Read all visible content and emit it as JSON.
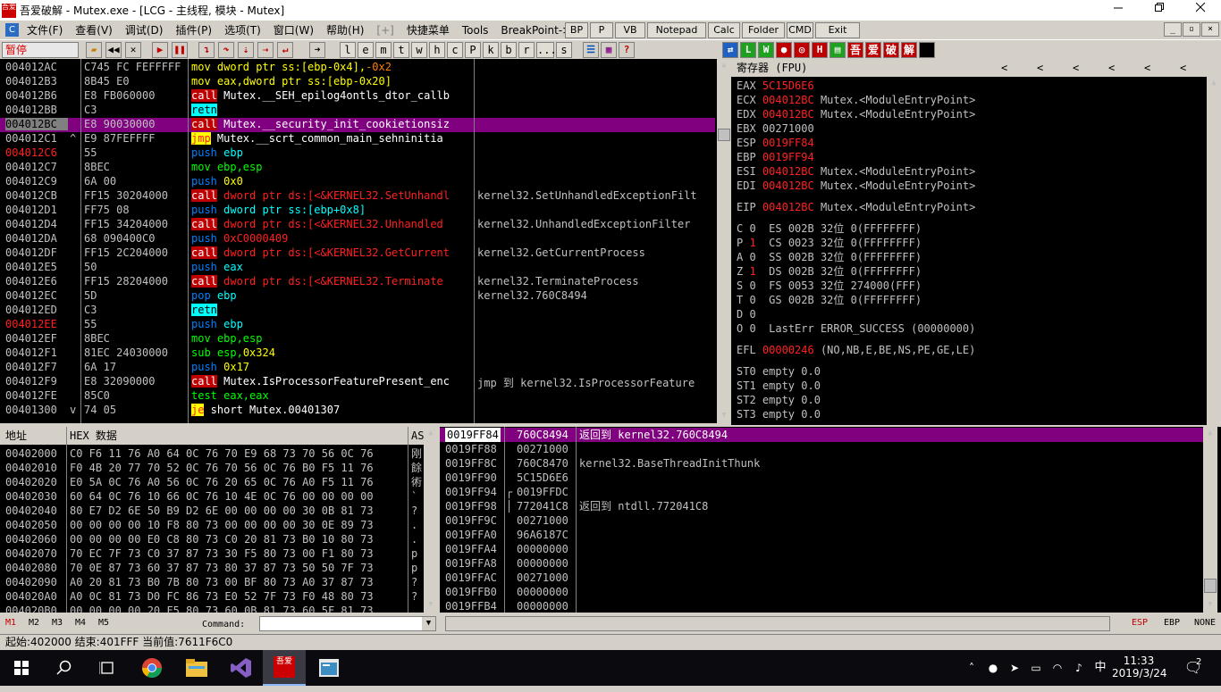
{
  "window": {
    "title": "吾爱破解 - Mutex.exe - [LCG - 主线程, 模块 - Mutex]",
    "icon_text": "吾爱",
    "controls": [
      "minimize-icon",
      "restore-icon",
      "close-icon"
    ]
  },
  "menu": {
    "items": [
      "文件(F)",
      "查看(V)",
      "调试(D)",
      "插件(P)",
      "选项(T)",
      "窗口(W)",
      "帮助(H)",
      "[+]",
      "快捷菜单",
      "Tools",
      "BreakPoint->"
    ],
    "plugin_buttons": [
      "BP",
      "P",
      "VB",
      "Notepad",
      "Calc",
      "Folder",
      "CMD",
      "Exit"
    ],
    "mdi_buttons": [
      "_",
      "▫",
      "×"
    ]
  },
  "toolbar": {
    "status": "暂停",
    "buttons": [
      "open",
      "rewind",
      "close",
      "run",
      "pause",
      "step-into",
      "step-over",
      "trace-into",
      "trace-over",
      "execute-till-return",
      "goto"
    ],
    "letter_buttons": [
      "l",
      "e",
      "m",
      "t",
      "w",
      "h",
      "c",
      "P",
      "k",
      "b",
      "r",
      "...",
      "s"
    ],
    "right_labels": [
      "L",
      "W",
      "H",
      "吾",
      "爱",
      "破",
      "解"
    ]
  },
  "cpu": {
    "rows": [
      {
        "addr": "004012AC",
        "hex": "C745 FC FEFFFFF",
        "dis": [
          {
            "t": "mov",
            "c": "#ffff00",
            "bg": ""
          },
          {
            "t": " dword ptr ss:[ebp-0x4],",
            "c": "#ffff00",
            "bg": ""
          },
          {
            "t": "-0x2",
            "c": "#ff8000",
            "bg": ""
          }
        ],
        "com": "",
        "addr_color": "#c0c0c0",
        "mark": ""
      },
      {
        "addr": "004012B3",
        "hex": "8B45 E0",
        "dis": [
          {
            "t": "mov",
            "c": "#ffff00",
            "bg": ""
          },
          {
            "t": " eax,dword ptr ss:[ebp-0x20]",
            "c": "#ffff00",
            "bg": ""
          }
        ],
        "com": "",
        "addr_color": "#c0c0c0",
        "mark": ""
      },
      {
        "addr": "004012B6",
        "hex": "E8 FB060000",
        "dis": [
          {
            "t": "call",
            "c": "#ffffff",
            "bg": "#c00000"
          },
          {
            "t": " Mutex.__SEH_epilog4ontls_dtor_callb",
            "c": "#ffffff",
            "bg": ""
          }
        ],
        "com": "",
        "addr_color": "#c0c0c0",
        "mark": ""
      },
      {
        "addr": "004012BB",
        "hex": "C3",
        "dis": [
          {
            "t": "retn",
            "c": "#000000",
            "bg": "#00ffff"
          }
        ],
        "com": "",
        "addr_color": "#c0c0c0",
        "mark": ""
      },
      {
        "addr": "004012BC",
        "hex": "E8 90030000",
        "dis": [
          {
            "t": "call",
            "c": "#ffffff",
            "bg": "#c00000"
          },
          {
            "t": " Mutex.__security_init_cookietionsiz",
            "c": "#ffffff",
            "bg": ""
          }
        ],
        "com": "",
        "addr_color": "#000000",
        "mark": "",
        "selected": true
      },
      {
        "addr": "004012C1",
        "hex": "E9 87FEFFFF",
        "dis": [
          {
            "t": "jmp",
            "c": "#ff2020",
            "bg": "#ffff00"
          },
          {
            "t": " Mutex.__scrt_common_main_sehninitia",
            "c": "#ffffff",
            "bg": ""
          }
        ],
        "com": "",
        "addr_color": "#c0c0c0",
        "mark": "^"
      },
      {
        "addr": "004012C6",
        "hex": "55",
        "dis": [
          {
            "t": "push",
            "c": "#0080ff",
            "bg": ""
          },
          {
            "t": " ebp",
            "c": "#00ffff",
            "bg": ""
          }
        ],
        "com": "",
        "addr_color": "#ff2020",
        "mark": ""
      },
      {
        "addr": "004012C7",
        "hex": "8BEC",
        "dis": [
          {
            "t": "mov",
            "c": "#00ff00",
            "bg": ""
          },
          {
            "t": " ebp,esp",
            "c": "#00ff00",
            "bg": ""
          }
        ],
        "com": "",
        "addr_color": "#c0c0c0",
        "mark": ""
      },
      {
        "addr": "004012C9",
        "hex": "6A 00",
        "dis": [
          {
            "t": "push",
            "c": "#0080ff",
            "bg": ""
          },
          {
            "t": " 0x0",
            "c": "#ffff00",
            "bg": ""
          }
        ],
        "com": "",
        "addr_color": "#c0c0c0",
        "mark": ""
      },
      {
        "addr": "004012CB",
        "hex": "FF15 30204000",
        "dis": [
          {
            "t": "call",
            "c": "#ffffff",
            "bg": "#c00000"
          },
          {
            "t": " dword ptr ds:[<&KERNEL32.SetUnhandl",
            "c": "#ff2020",
            "bg": ""
          }
        ],
        "com": "kernel32.SetUnhandledExceptionFilt",
        "addr_color": "#c0c0c0",
        "mark": ""
      },
      {
        "addr": "004012D1",
        "hex": "FF75 08",
        "dis": [
          {
            "t": "push",
            "c": "#0080ff",
            "bg": ""
          },
          {
            "t": " dword ptr ss:[ebp+0x8]",
            "c": "#00ffff",
            "bg": ""
          }
        ],
        "com": "",
        "addr_color": "#c0c0c0",
        "mark": ""
      },
      {
        "addr": "004012D4",
        "hex": "FF15 34204000",
        "dis": [
          {
            "t": "call",
            "c": "#ffffff",
            "bg": "#c00000"
          },
          {
            "t": " dword ptr ds:[<&KERNEL32.Unhandled",
            "c": "#ff2020",
            "bg": ""
          }
        ],
        "com": "kernel32.UnhandledExceptionFilter",
        "addr_color": "#c0c0c0",
        "mark": ""
      },
      {
        "addr": "004012DA",
        "hex": "68 090400C0",
        "dis": [
          {
            "t": "push",
            "c": "#0080ff",
            "bg": ""
          },
          {
            "t": " 0xC0000409",
            "c": "#ff2020",
            "bg": ""
          }
        ],
        "com": "",
        "addr_color": "#c0c0c0",
        "mark": ""
      },
      {
        "addr": "004012DF",
        "hex": "FF15 2C204000",
        "dis": [
          {
            "t": "call",
            "c": "#ffffff",
            "bg": "#c00000"
          },
          {
            "t": " dword ptr ds:[<&KERNEL32.GetCurrent",
            "c": "#ff2020",
            "bg": ""
          }
        ],
        "com": "kernel32.GetCurrentProcess",
        "addr_color": "#c0c0c0",
        "mark": ""
      },
      {
        "addr": "004012E5",
        "hex": "50",
        "dis": [
          {
            "t": "push",
            "c": "#0080ff",
            "bg": ""
          },
          {
            "t": " eax",
            "c": "#00ffff",
            "bg": ""
          }
        ],
        "com": "",
        "addr_color": "#c0c0c0",
        "mark": ""
      },
      {
        "addr": "004012E6",
        "hex": "FF15 28204000",
        "dis": [
          {
            "t": "call",
            "c": "#ffffff",
            "bg": "#c00000"
          },
          {
            "t": " dword ptr ds:[<&KERNEL32.Terminate",
            "c": "#ff2020",
            "bg": ""
          }
        ],
        "com": "kernel32.TerminateProcess",
        "addr_color": "#c0c0c0",
        "mark": ""
      },
      {
        "addr": "004012EC",
        "hex": "5D",
        "dis": [
          {
            "t": "pop",
            "c": "#0080ff",
            "bg": ""
          },
          {
            "t": " ebp",
            "c": "#00ffff",
            "bg": ""
          }
        ],
        "com": "kernel32.760C8494",
        "addr_color": "#c0c0c0",
        "mark": ""
      },
      {
        "addr": "004012ED",
        "hex": "C3",
        "dis": [
          {
            "t": "retn",
            "c": "#000000",
            "bg": "#00ffff"
          }
        ],
        "com": "",
        "addr_color": "#c0c0c0",
        "mark": ""
      },
      {
        "addr": "004012EE",
        "hex": "55",
        "dis": [
          {
            "t": "push",
            "c": "#0080ff",
            "bg": ""
          },
          {
            "t": " ebp",
            "c": "#00ffff",
            "bg": ""
          }
        ],
        "com": "",
        "addr_color": "#ff2020",
        "mark": ""
      },
      {
        "addr": "004012EF",
        "hex": "8BEC",
        "dis": [
          {
            "t": "mov",
            "c": "#00ff00",
            "bg": ""
          },
          {
            "t": " ebp,esp",
            "c": "#00ff00",
            "bg": ""
          }
        ],
        "com": "",
        "addr_color": "#c0c0c0",
        "mark": ""
      },
      {
        "addr": "004012F1",
        "hex": "81EC 24030000",
        "dis": [
          {
            "t": "sub",
            "c": "#00ff00",
            "bg": ""
          },
          {
            "t": " esp,",
            "c": "#00ff00",
            "bg": ""
          },
          {
            "t": "0x324",
            "c": "#ffff00",
            "bg": ""
          }
        ],
        "com": "",
        "addr_color": "#c0c0c0",
        "mark": ""
      },
      {
        "addr": "004012F7",
        "hex": "6A 17",
        "dis": [
          {
            "t": "push",
            "c": "#0080ff",
            "bg": ""
          },
          {
            "t": " 0x17",
            "c": "#ffff00",
            "bg": ""
          }
        ],
        "com": "",
        "addr_color": "#c0c0c0",
        "mark": ""
      },
      {
        "addr": "004012F9",
        "hex": "E8 32090000",
        "dis": [
          {
            "t": "call",
            "c": "#ffffff",
            "bg": "#c00000"
          },
          {
            "t": " Mutex.IsProcessorFeaturePresent_enc",
            "c": "#ffffff",
            "bg": ""
          }
        ],
        "com": "jmp 到 kernel32.IsProcessorFeature",
        "addr_color": "#c0c0c0",
        "mark": ""
      },
      {
        "addr": "004012FE",
        "hex": "85C0",
        "dis": [
          {
            "t": "test",
            "c": "#00ff00",
            "bg": ""
          },
          {
            "t": " eax,eax",
            "c": "#00ff00",
            "bg": ""
          }
        ],
        "com": "",
        "addr_color": "#c0c0c0",
        "mark": ""
      },
      {
        "addr": "00401300",
        "hex": "74 05",
        "dis": [
          {
            "t": "je",
            "c": "#ff2020",
            "bg": "#ffff00"
          },
          {
            "t": " short Mutex.00401307",
            "c": "#ffffff",
            "bg": ""
          }
        ],
        "com": "",
        "addr_color": "#c0c0c0",
        "mark": "v"
      }
    ]
  },
  "registers": {
    "header": "寄存器 (FPU)",
    "arrows": [
      "<",
      "<",
      "<",
      "<",
      "<",
      "<"
    ],
    "gp": [
      {
        "name": "EAX",
        "value": "5C15D6E6",
        "red": true,
        "comment": ""
      },
      {
        "name": "ECX",
        "value": "004012BC",
        "red": true,
        "comment": "Mutex.<ModuleEntryPoint>"
      },
      {
        "name": "EDX",
        "value": "004012BC",
        "red": true,
        "comment": "Mutex.<ModuleEntryPoint>"
      },
      {
        "name": "EBX",
        "value": "00271000",
        "red": false,
        "comment": ""
      },
      {
        "name": "ESP",
        "value": "0019FF84",
        "red": true,
        "comment": ""
      },
      {
        "name": "EBP",
        "value": "0019FF94",
        "red": true,
        "comment": ""
      },
      {
        "name": "ESI",
        "value": "004012BC",
        "red": true,
        "comment": "Mutex.<ModuleEntryPoint>"
      },
      {
        "name": "EDI",
        "value": "004012BC",
        "red": true,
        "comment": "Mutex.<ModuleEntryPoint>"
      }
    ],
    "eip": {
      "name": "EIP",
      "value": "004012BC",
      "comment": "Mutex.<ModuleEntryPoint>"
    },
    "flags": [
      {
        "f": "C",
        "v": "0",
        "red": false,
        "seg": "ES 002B 32位 0(FFFFFFFF)"
      },
      {
        "f": "P",
        "v": "1",
        "red": true,
        "seg": "CS 0023 32位 0(FFFFFFFF)"
      },
      {
        "f": "A",
        "v": "0",
        "red": false,
        "seg": "SS 002B 32位 0(FFFFFFFF)"
      },
      {
        "f": "Z",
        "v": "1",
        "red": true,
        "seg": "DS 002B 32位 0(FFFFFFFF)"
      },
      {
        "f": "S",
        "v": "0",
        "red": false,
        "seg": "FS 0053 32位 274000(FFF)"
      },
      {
        "f": "T",
        "v": "0",
        "red": false,
        "seg": "GS 002B 32位 0(FFFFFFFF)"
      },
      {
        "f": "D",
        "v": "0",
        "red": false,
        "seg": ""
      },
      {
        "f": "O",
        "v": "0",
        "red": false,
        "seg": "LastErr ERROR_SUCCESS (00000000)"
      }
    ],
    "efl": {
      "name": "EFL",
      "value": "00000246",
      "comment": "(NO,NB,E,BE,NS,PE,GE,LE)"
    },
    "fpu": [
      "ST0 empty 0.0",
      "ST1 empty 0.0",
      "ST2 empty 0.0",
      "ST3 empty 0.0"
    ]
  },
  "dump": {
    "col_addr": "地址",
    "col_hex": "HEX 数据",
    "col_ascii": "AS",
    "rows": [
      {
        "addr": "00402000",
        "hex": "C0 F6 11 76 A0 64 0C 76 70 E9 68 73 70 56 0C 76",
        "asc": "刚"
      },
      {
        "addr": "00402010",
        "hex": "F0 4B 20 77 70 52 0C 76 70 56 0C 76 B0 F5 11 76",
        "asc": "餘"
      },
      {
        "addr": "00402020",
        "hex": "E0 5A 0C 76 A0 56 0C 76 20 65 0C 76 A0 F5 11 76",
        "asc": "術"
      },
      {
        "addr": "00402030",
        "hex": "60 64 0C 76 10 66 0C 76 10 4E 0C 76 00 00 00 00",
        "asc": "`"
      },
      {
        "addr": "00402040",
        "hex": "80 E7 D2 6E 50 B9 D2 6E 00 00 00 00 30 0B 81 73",
        "asc": "?"
      },
      {
        "addr": "00402050",
        "hex": "00 00 00 00 10 F8 80 73 00 00 00 00 30 0E 89 73",
        "asc": "."
      },
      {
        "addr": "00402060",
        "hex": "00 00 00 00 E0 C8 80 73 C0 20 81 73 B0 10 80 73",
        "asc": "."
      },
      {
        "addr": "00402070",
        "hex": "70 EC 7F 73 C0 37 87 73 30 F5 80 73 00 F1 80 73",
        "asc": "p"
      },
      {
        "addr": "00402080",
        "hex": "70 0E 87 73 60 37 87 73 80 37 87 73 50 50 7F 73",
        "asc": "p"
      },
      {
        "addr": "00402090",
        "hex": "A0 20 81 73 B0 7B 80 73 00 BF 80 73 A0 37 87 73",
        "asc": "?"
      },
      {
        "addr": "004020A0",
        "hex": "A0 0C 81 73 D0 FC 86 73 E0 52 7F 73 F0 48 80 73",
        "asc": "?"
      },
      {
        "addr": "004020B0",
        "hex": "00 00 00 00 20 F5 80 73 60 0B 81 73 60 5F 81 73",
        "asc": "."
      }
    ]
  },
  "stack": {
    "rows": [
      {
        "addr": "0019FF84",
        "val": "760C8494",
        "com": "返回到 kernel32.760C8494",
        "sel": true,
        "mark": ""
      },
      {
        "addr": "0019FF88",
        "val": "00271000",
        "com": "",
        "sel": false,
        "mark": ""
      },
      {
        "addr": "0019FF8C",
        "val": "760C8470",
        "com": "kernel32.BaseThreadInitThunk",
        "sel": false,
        "mark": ""
      },
      {
        "addr": "0019FF90",
        "val": "5C15D6E6",
        "com": "",
        "sel": false,
        "mark": ""
      },
      {
        "addr": "0019FF94",
        "val": "0019FFDC",
        "com": "",
        "sel": false,
        "mark": "┌"
      },
      {
        "addr": "0019FF98",
        "val": "772041C8",
        "com": "返回到 ntdll.772041C8",
        "sel": false,
        "mark": "│"
      },
      {
        "addr": "0019FF9C",
        "val": "00271000",
        "com": "",
        "sel": false,
        "mark": ""
      },
      {
        "addr": "0019FFA0",
        "val": "96A6187C",
        "com": "",
        "sel": false,
        "mark": ""
      },
      {
        "addr": "0019FFA4",
        "val": "00000000",
        "com": "",
        "sel": false,
        "mark": ""
      },
      {
        "addr": "0019FFA8",
        "val": "00000000",
        "com": "",
        "sel": false,
        "mark": ""
      },
      {
        "addr": "0019FFAC",
        "val": "00271000",
        "com": "",
        "sel": false,
        "mark": ""
      },
      {
        "addr": "0019FFB0",
        "val": "00000000",
        "com": "",
        "sel": false,
        "mark": ""
      },
      {
        "addr": "0019FFB4",
        "val": "00000000",
        "com": "",
        "sel": false,
        "mark": ""
      }
    ]
  },
  "command": {
    "markers": [
      "M1",
      "M2",
      "M3",
      "M4",
      "M5"
    ],
    "label": "Command:",
    "value": "",
    "right": [
      "ESP",
      "EBP",
      "NONE"
    ]
  },
  "status": {
    "text": "起始:402000 结束:401FFF 当前值:7611F6C0"
  },
  "taskbar": {
    "apps": [
      "windows-start-icon",
      "search-icon",
      "task-view-icon",
      "chrome-icon",
      "file-explorer-icon",
      "visual-studio-icon",
      "52pojie-icon",
      "app-window-icon"
    ],
    "clock_time": "11:33",
    "clock_date": "2019/3/24",
    "ime": "中",
    "notification_count": "2",
    "colors": {
      "taskbar_bg": "#0b0b0f",
      "accent": "#800080"
    }
  }
}
